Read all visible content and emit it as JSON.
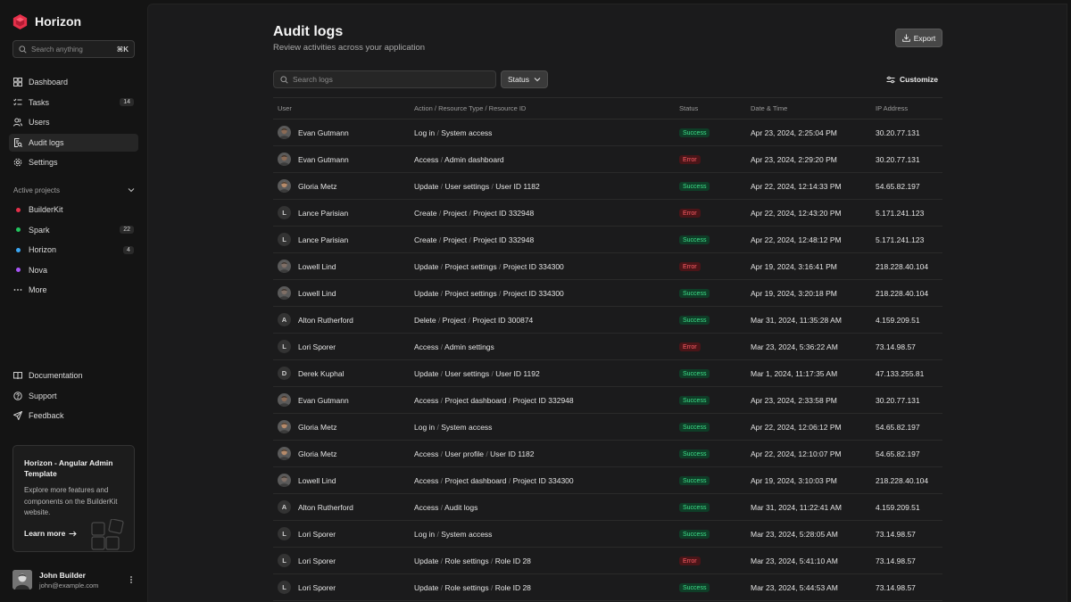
{
  "app": {
    "name": "Horizon",
    "brand_color": "#e5304a"
  },
  "sidebar": {
    "search_placeholder": "Search anything",
    "search_shortcut": "⌘K",
    "nav": [
      {
        "label": "Dashboard",
        "icon": "dashboard-icon",
        "badge": ""
      },
      {
        "label": "Tasks",
        "icon": "tasks-icon",
        "badge": "14"
      },
      {
        "label": "Users",
        "icon": "users-icon",
        "badge": ""
      },
      {
        "label": "Audit logs",
        "icon": "audit-logs-icon",
        "badge": "",
        "active": true
      },
      {
        "label": "Settings",
        "icon": "settings-icon",
        "badge": ""
      }
    ],
    "projects_header": "Active projects",
    "projects": [
      {
        "label": "BuilderKit",
        "color": "#e5304a",
        "badge": ""
      },
      {
        "label": "Spark",
        "color": "#22c55e",
        "badge": "22"
      },
      {
        "label": "Horizon",
        "color": "#3ba7f5",
        "badge": "4"
      },
      {
        "label": "Nova",
        "color": "#a855f7",
        "badge": ""
      }
    ],
    "more_label": "More",
    "footer": [
      {
        "label": "Documentation",
        "icon": "book-icon"
      },
      {
        "label": "Support",
        "icon": "support-icon"
      },
      {
        "label": "Feedback",
        "icon": "send-icon"
      }
    ],
    "promo": {
      "title": "Horizon - Angular Admin Template",
      "text": "Explore more features and components on the BuilderKit website.",
      "link": "Learn more"
    },
    "user": {
      "name": "John Builder",
      "email": "john@example.com"
    }
  },
  "main": {
    "title": "Audit logs",
    "subtitle": "Review activities across your application",
    "export_label": "Export",
    "search_placeholder": "Search logs",
    "status_filter": "Status",
    "customize_label": "Customize",
    "columns": {
      "user": "User",
      "action": "Action / Resource Type / Resource ID",
      "status": "Status",
      "date": "Date & Time",
      "ip": "IP Address"
    },
    "rows": [
      {
        "user": "Evan Gutmann",
        "avatar": "photo",
        "tone": "#8a6a55",
        "action": [
          "Log in",
          "System access"
        ],
        "status": "Success",
        "date": "Apr 23, 2024, 2:25:04 PM",
        "ip": "30.20.77.131"
      },
      {
        "user": "Evan Gutmann",
        "avatar": "photo",
        "tone": "#8a6a55",
        "action": [
          "Access",
          "Admin dashboard"
        ],
        "status": "Error",
        "date": "Apr 23, 2024, 2:29:20 PM",
        "ip": "30.20.77.131"
      },
      {
        "user": "Gloria Metz",
        "avatar": "photo",
        "tone": "#b58a6a",
        "action": [
          "Update",
          "User settings",
          "User ID 1182"
        ],
        "status": "Success",
        "date": "Apr 22, 2024, 12:14:33 PM",
        "ip": "54.65.82.197"
      },
      {
        "user": "Lance Parisian",
        "avatar": "L",
        "action": [
          "Create",
          "Project",
          "Project ID 332948"
        ],
        "status": "Error",
        "date": "Apr 22, 2024, 12:43:20 PM",
        "ip": "5.171.241.123"
      },
      {
        "user": "Lance Parisian",
        "avatar": "L",
        "action": [
          "Create",
          "Project",
          "Project ID 332948"
        ],
        "status": "Success",
        "date": "Apr 22, 2024, 12:48:12 PM",
        "ip": "5.171.241.123"
      },
      {
        "user": "Lowell Lind",
        "avatar": "photo",
        "tone": "#7f6f66",
        "action": [
          "Update",
          "Project settings",
          "Project ID 334300"
        ],
        "status": "Error",
        "date": "Apr 19, 2024, 3:16:41 PM",
        "ip": "218.228.40.104"
      },
      {
        "user": "Lowell Lind",
        "avatar": "photo",
        "tone": "#7f6f66",
        "action": [
          "Update",
          "Project settings",
          "Project ID 334300"
        ],
        "status": "Success",
        "date": "Apr 19, 2024, 3:20:18 PM",
        "ip": "218.228.40.104"
      },
      {
        "user": "Alton Rutherford",
        "avatar": "A",
        "action": [
          "Delete",
          "Project",
          "Project ID 300874"
        ],
        "status": "Success",
        "date": "Mar 31, 2024, 11:35:28 AM",
        "ip": "4.159.209.51"
      },
      {
        "user": "Lori Sporer",
        "avatar": "L",
        "action": [
          "Access",
          "Admin settings"
        ],
        "status": "Error",
        "date": "Mar 23, 2024, 5:36:22 AM",
        "ip": "73.14.98.57"
      },
      {
        "user": "Derek Kuphal",
        "avatar": "D",
        "action": [
          "Update",
          "User settings",
          "User ID 1192"
        ],
        "status": "Success",
        "date": "Mar 1, 2024, 11:17:35 AM",
        "ip": "47.133.255.81"
      },
      {
        "user": "Evan Gutmann",
        "avatar": "photo",
        "tone": "#8a6a55",
        "action": [
          "Access",
          "Project dashboard",
          "Project ID 332948"
        ],
        "status": "Success",
        "date": "Apr 23, 2024, 2:33:58 PM",
        "ip": "30.20.77.131"
      },
      {
        "user": "Gloria Metz",
        "avatar": "photo",
        "tone": "#b58a6a",
        "action": [
          "Log in",
          "System access"
        ],
        "status": "Success",
        "date": "Apr 22, 2024, 12:06:12 PM",
        "ip": "54.65.82.197"
      },
      {
        "user": "Gloria Metz",
        "avatar": "photo",
        "tone": "#b58a6a",
        "action": [
          "Access",
          "User profile",
          "User ID 1182"
        ],
        "status": "Success",
        "date": "Apr 22, 2024, 12:10:07 PM",
        "ip": "54.65.82.197"
      },
      {
        "user": "Lowell Lind",
        "avatar": "photo",
        "tone": "#7f6f66",
        "action": [
          "Access",
          "Project dashboard",
          "Project ID 334300"
        ],
        "status": "Success",
        "date": "Apr 19, 2024, 3:10:03 PM",
        "ip": "218.228.40.104"
      },
      {
        "user": "Alton Rutherford",
        "avatar": "A",
        "action": [
          "Access",
          "Audit logs"
        ],
        "status": "Success",
        "date": "Mar 31, 2024, 11:22:41 AM",
        "ip": "4.159.209.51"
      },
      {
        "user": "Lori Sporer",
        "avatar": "L",
        "action": [
          "Log in",
          "System access"
        ],
        "status": "Success",
        "date": "Mar 23, 2024, 5:28:05 AM",
        "ip": "73.14.98.57"
      },
      {
        "user": "Lori Sporer",
        "avatar": "L",
        "action": [
          "Update",
          "Role settings",
          "Role ID 28"
        ],
        "status": "Error",
        "date": "Mar 23, 2024, 5:41:10 AM",
        "ip": "73.14.98.57"
      },
      {
        "user": "Lori Sporer",
        "avatar": "L",
        "action": [
          "Update",
          "Role settings",
          "Role ID 28"
        ],
        "status": "Success",
        "date": "Mar 23, 2024, 5:44:53 AM",
        "ip": "73.14.98.57"
      }
    ]
  }
}
